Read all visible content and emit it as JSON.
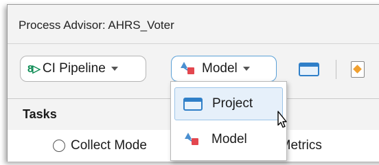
{
  "window": {
    "title": "Process Advisor: AHRS_Voter"
  },
  "toolbar": {
    "ci_pipeline_label": "CI Pipeline",
    "ci_pipeline_icon": "ci-pipeline-icon",
    "model_label": "Model",
    "model_icon": "model-icon"
  },
  "dropdown": {
    "items": [
      {
        "label": "Project",
        "icon": "project-icon",
        "highlighted": true
      },
      {
        "label": "Model",
        "icon": "model-icon",
        "highlighted": false
      }
    ]
  },
  "tasks": {
    "header": "Tasks",
    "rows": [
      {
        "label_left": "Collect Mode",
        "label_right": "y Metrics"
      }
    ]
  },
  "colors": {
    "accent": "#2f7fc8",
    "ci_green": "#0a8a52",
    "model_red": "#e3474f"
  }
}
